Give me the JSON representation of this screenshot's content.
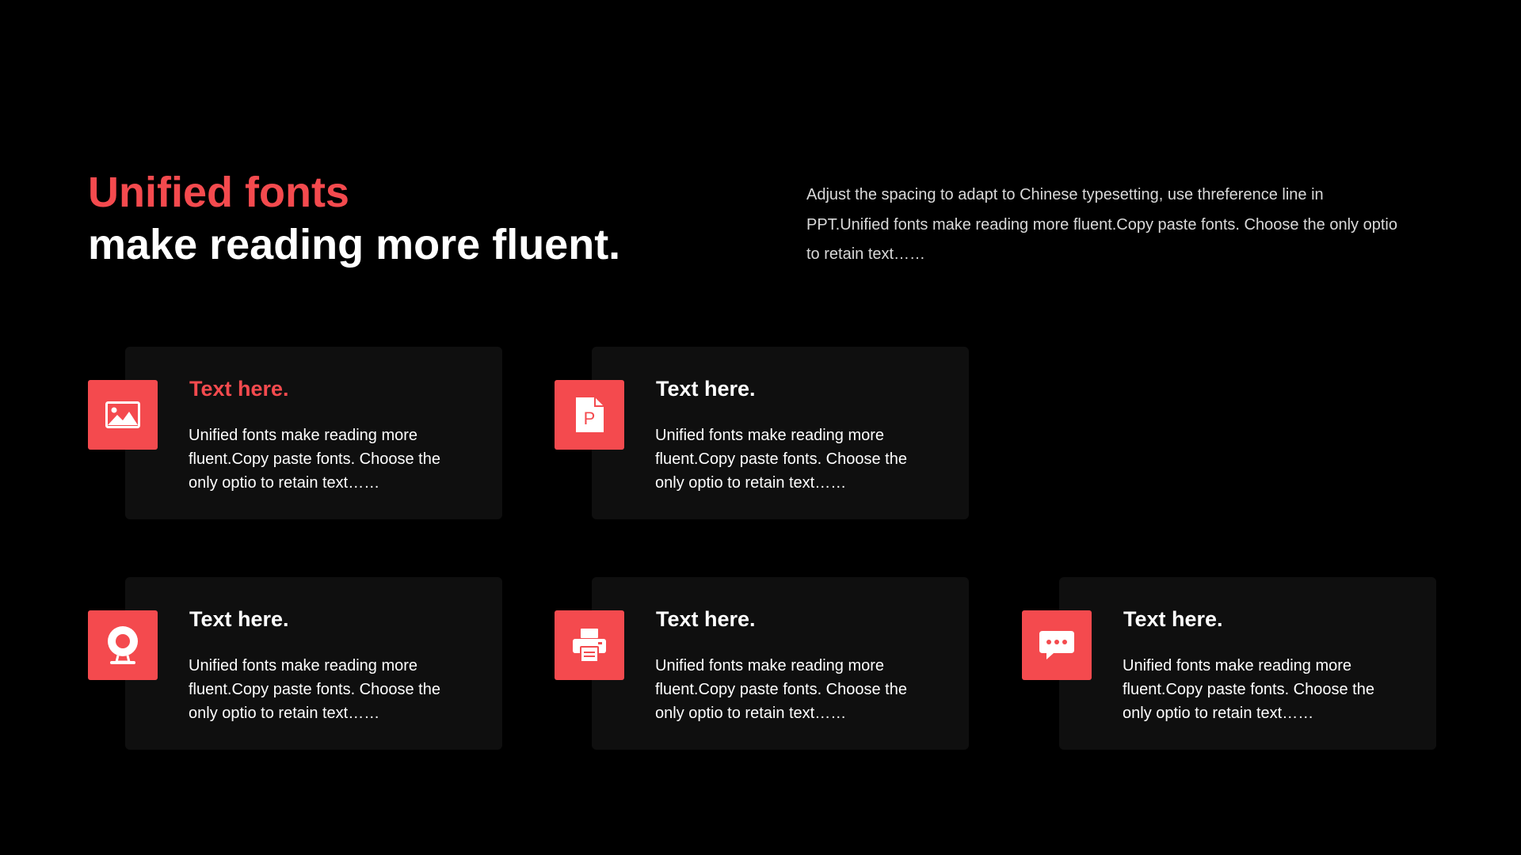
{
  "heading": {
    "accent": "Unified fonts",
    "main": "make reading more fluent."
  },
  "intro": "Adjust the spacing to adapt to Chinese typesetting, use threference line in PPT.Unified fonts make reading more fluent.Copy paste fonts. Choose the only optio to retain text……",
  "colors": {
    "accent": "#f44a4e",
    "background": "#000000",
    "card": "#0f0f0f"
  },
  "cards": [
    {
      "icon": "image-icon",
      "title": "Text here.",
      "text": "Unified fonts make reading more fluent.Copy paste fonts. Choose the only optio to retain text……"
    },
    {
      "icon": "ppt-file-icon",
      "title": "Text here.",
      "text": "Unified fonts make reading more fluent.Copy paste fonts. Choose the only optio to retain text……"
    },
    {
      "icon": "webcam-icon",
      "title": "Text here.",
      "text": "Unified fonts make reading more fluent.Copy paste fonts. Choose the only optio to retain text……"
    },
    {
      "icon": "printer-icon",
      "title": "Text here.",
      "text": "Unified fonts make reading more fluent.Copy paste fonts. Choose the only optio to retain text……"
    },
    {
      "icon": "chat-bubble-icon",
      "title": "Text here.",
      "text": "Unified fonts make reading more fluent.Copy paste fonts. Choose the only optio to retain text……"
    }
  ]
}
